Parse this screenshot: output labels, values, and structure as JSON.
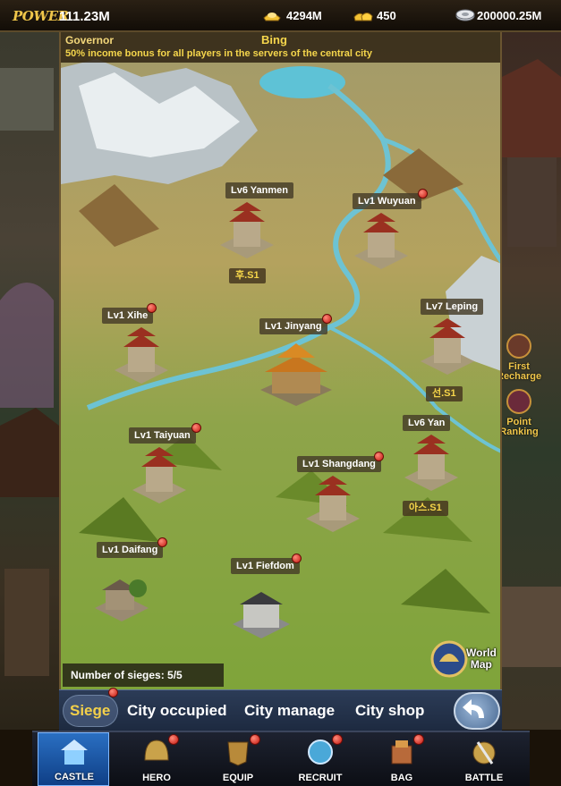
{
  "topbar": {
    "power_label": "POWER",
    "power_value": "111.23M",
    "gold": "4294M",
    "ingots": "450",
    "silver": "200000.25M",
    "icons": [
      "gold-ingot-icon",
      "ingot-pile-icon",
      "silver-coin-icon"
    ]
  },
  "governor": {
    "label": "Governor",
    "name": "Bing",
    "description": "50% income bonus for all players in the servers of the central city"
  },
  "cities": [
    {
      "label": "Lv6 Yanmen",
      "owner": "후.S1",
      "alert": false
    },
    {
      "label": "Lv1 Wuyuan",
      "owner": "",
      "alert": true
    },
    {
      "label": "Lv1 Xihe",
      "owner": "",
      "alert": true
    },
    {
      "label": "Lv1 Jinyang",
      "owner": "",
      "alert": true
    },
    {
      "label": "Lv7 Leping",
      "owner": "선.S1",
      "alert": false
    },
    {
      "label": "Lv1 Taiyuan",
      "owner": "",
      "alert": true
    },
    {
      "label": "Lv6 Yan",
      "owner": "아스.S1",
      "alert": false
    },
    {
      "label": "Lv1 Shangdang",
      "owner": "",
      "alert": true
    },
    {
      "label": "Lv1 Daifang",
      "owner": "",
      "alert": true
    },
    {
      "label": "Lv1 Fiefdom",
      "owner": "",
      "alert": true
    }
  ],
  "sieges": "Number of sieges: 5/5",
  "world_map": {
    "line1": "World",
    "line2": "Map"
  },
  "side_buttons": [
    {
      "line1": "First",
      "line2": "Recharge"
    },
    {
      "line1": "Point",
      "line2": "Ranking"
    }
  ],
  "tabs": [
    "Siege",
    "City occupied",
    "City manage",
    "City shop"
  ],
  "active_tab": "Siege",
  "nav": [
    {
      "label": "CASTLE",
      "icon": "castle-icon",
      "active": true
    },
    {
      "label": "HERO",
      "icon": "helmet-icon"
    },
    {
      "label": "EQUIP",
      "icon": "armor-icon"
    },
    {
      "label": "RECRUIT",
      "icon": "recruit-icon"
    },
    {
      "label": "BAG",
      "icon": "bag-icon"
    },
    {
      "label": "BATTLE",
      "icon": "battle-icon"
    }
  ],
  "colors": {
    "accent_gold": "#f5d64c",
    "nav_active": "#2a6fc2",
    "alert_red": "#c2160e"
  }
}
